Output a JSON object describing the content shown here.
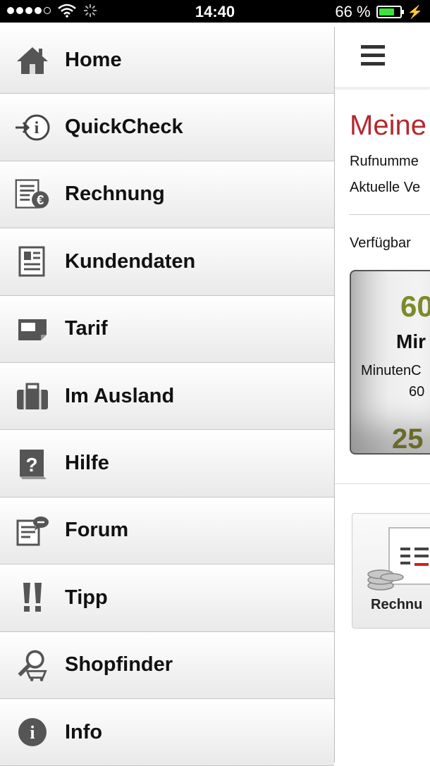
{
  "status_bar": {
    "time": "14:40",
    "battery": "66 %"
  },
  "menu": {
    "items": [
      {
        "label": "Home",
        "icon": "home-icon"
      },
      {
        "label": "QuickCheck",
        "icon": "quickcheck-icon"
      },
      {
        "label": "Rechnung",
        "icon": "invoice-euro-icon"
      },
      {
        "label": "Kundendaten",
        "icon": "customer-data-icon"
      },
      {
        "label": "Tarif",
        "icon": "tariff-card-icon"
      },
      {
        "label": "Im Ausland",
        "icon": "suitcase-icon"
      },
      {
        "label": "Hilfe",
        "icon": "help-icon"
      },
      {
        "label": "Forum",
        "icon": "forum-icon"
      },
      {
        "label": "Tipp",
        "icon": "tip-exclamation-icon"
      },
      {
        "label": "Shopfinder",
        "icon": "shopfinder-icon"
      },
      {
        "label": "Info",
        "icon": "info-icon"
      }
    ]
  },
  "content": {
    "title": "Meine",
    "line1": "Rufnumme",
    "line2": "Aktuelle Ve",
    "available": "Verfügbar",
    "card": {
      "number": "60",
      "unit": "Mir",
      "subtitle": "MinutenC",
      "subtitle2": "60",
      "big": "25"
    },
    "tile_label": "Rechnu"
  },
  "colors": {
    "accent": "#b5282e",
    "card_number": "#7e8a2a"
  }
}
